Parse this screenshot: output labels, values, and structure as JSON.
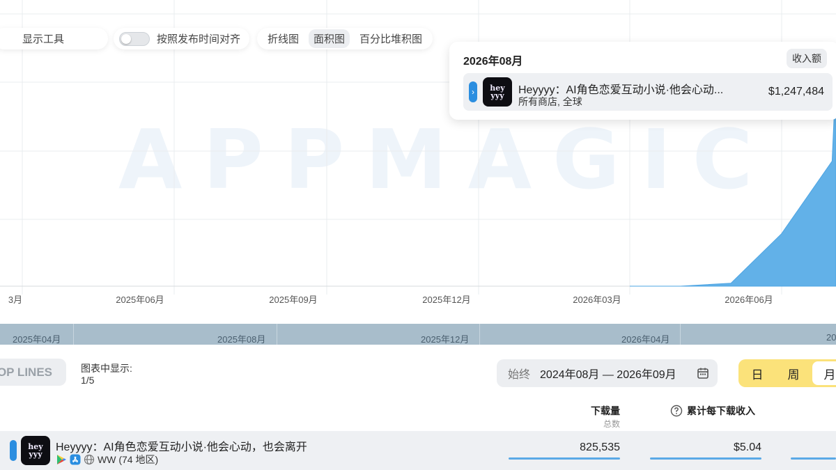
{
  "toolbar": {
    "tools_label": "显示工具",
    "align_label": "按照发布时间对齐",
    "chart_types": [
      {
        "label": "折线图",
        "active": false
      },
      {
        "label": "面积图",
        "active": true
      },
      {
        "label": "百分比堆积图",
        "active": false
      }
    ]
  },
  "watermark": "APPMAGIC",
  "tooltip": {
    "title": "2026年08月",
    "badge": "收入额",
    "app_name": "Heyyyy：AI角色恋爱互动小说·他会心动...",
    "app_sub": "所有商店, 全球",
    "value": "$1,247,484",
    "icon_text_top": "hey",
    "icon_text_bottom": "yyy"
  },
  "chart_data": {
    "type": "area",
    "x_tick_labels": [
      "3月",
      "2025年06月",
      "2025年09月",
      "2025年12月",
      "2026年03月",
      "2026年06月"
    ],
    "x": [
      "2026-03",
      "2026-04",
      "2026-05",
      "2026-06",
      "2026-07",
      "2026-08"
    ],
    "series": [
      {
        "values": [
          0,
          0,
          15000,
          260000,
          620000,
          1050000
        ],
        "color": "#62b1e8"
      }
    ],
    "grid": true
  },
  "navigator": {
    "labels": [
      "2025年04月",
      "2025年08月",
      "2025年12月",
      "2026年04月",
      "20"
    ]
  },
  "controls": {
    "top_lines_label": "OP LINES",
    "shown_label": "图表中显示:",
    "shown_count": "1/5",
    "date_prefix": "始终",
    "date_range": "2024年08月 — 2026年09月",
    "granularity": [
      {
        "label": "日",
        "active": false
      },
      {
        "label": "周",
        "active": false
      },
      {
        "label": "月",
        "active": true
      }
    ]
  },
  "table": {
    "col_downloads": "下载量",
    "col_downloads_sub": "总数",
    "col_arpu": "累计每下载收入",
    "row": {
      "name": "Heyyyy：AI角色恋爱互动小说·他会心动，也会离开",
      "region": "WW (74 地区)",
      "downloads": "825,535",
      "arpu": "$5.04"
    }
  }
}
